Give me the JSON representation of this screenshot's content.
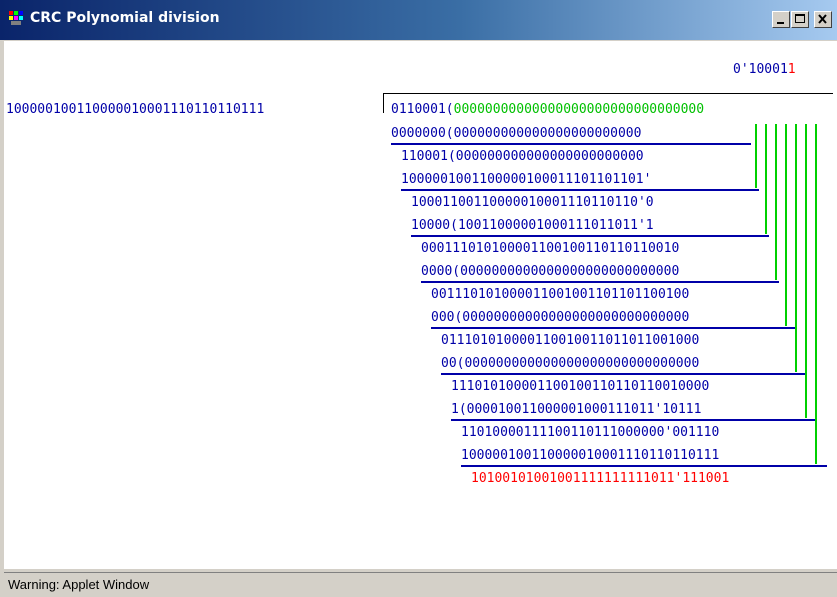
{
  "window": {
    "title": "CRC Polynomial division",
    "controls": {
      "minimize_icon": "minimize-icon",
      "maximize_icon": "maximize-icon",
      "close_icon": "close-icon"
    }
  },
  "division": {
    "quotient_prefix": "0",
    "quotient_mark": "'",
    "quotient_main": "10001",
    "quotient_last": "1",
    "divisor": "100000100110000010001110110110111",
    "dividend_blue": "0110001(",
    "dividend_green": "00000000000000000000000000000000",
    "rows": [
      {
        "text": "0000000(000000000000000000000000"
      },
      {
        "text": "110001(000000000000000000000000"
      },
      {
        "text": "1000001001100000100011101101101'"
      },
      {
        "text": "10001100110000010001110110110'0"
      },
      {
        "text": "10000(10011000001000111011011'1"
      },
      {
        "text": "000111010100001100100110110110010"
      },
      {
        "text": "0000(0000000000000000000000000000"
      },
      {
        "text": "001110101000011001001101101100100"
      },
      {
        "text": "000(00000000000000000000000000000"
      },
      {
        "text": "011101010000110010011011011001000"
      },
      {
        "text": "00(000000000000000000000000000000"
      },
      {
        "text": "111010100001100100110110110010000"
      },
      {
        "text": "1(000010011000001000111011'10111"
      },
      {
        "text": "11010000111100110111000000'001110"
      },
      {
        "text": "100000100110000010001110110110111"
      }
    ],
    "remainder": "10100101001001111111111011'111001",
    "colors": {
      "blue": "#0000a8",
      "green": "#00c000",
      "red": "#ff0000"
    }
  },
  "status": {
    "text": "Warning: Applet Window"
  }
}
